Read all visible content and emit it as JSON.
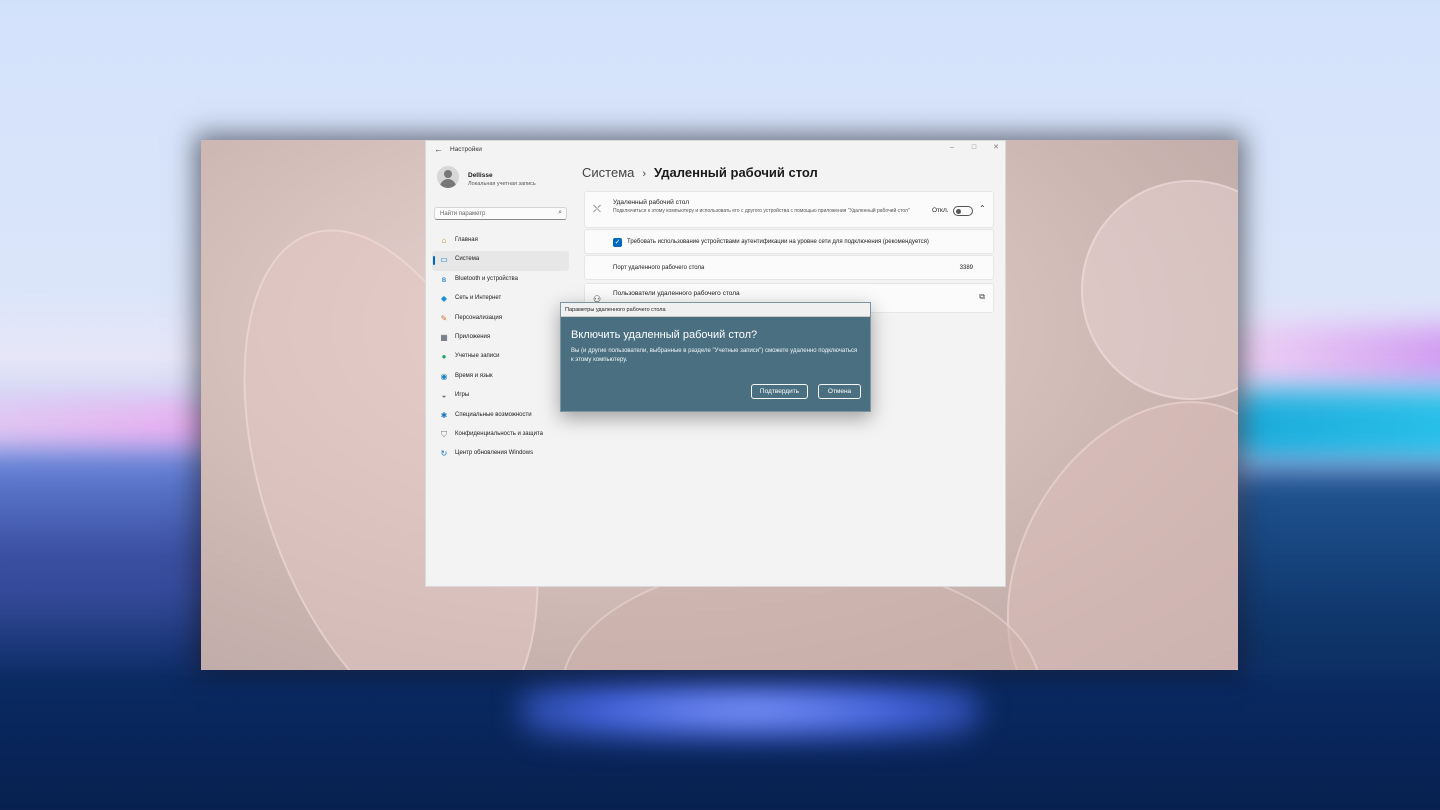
{
  "window": {
    "title": "Настройки",
    "back_icon": "arrow-left-icon",
    "controls": {
      "minimize_icon": "–",
      "maximize_icon": "□",
      "close_icon": "✕"
    }
  },
  "profile": {
    "name": "Dellisse",
    "account_type": "Локальная учетная запись",
    "avatar_icon": "person-avatar-icon"
  },
  "search": {
    "placeholder": "Найти параметр",
    "icon": "search-icon"
  },
  "nav": {
    "items": [
      {
        "label": "Главная",
        "icon": "home-icon",
        "glyph": "⌂",
        "color": "#c17a1b",
        "active": false
      },
      {
        "label": "Система",
        "icon": "monitor-icon",
        "glyph": "▭",
        "color": "#0a72c7",
        "active": true
      },
      {
        "label": "Bluetooth и устройства",
        "icon": "bluetooth-icon",
        "glyph": "ʙ",
        "color": "#0a72c7",
        "active": false
      },
      {
        "label": "Сеть и Интернет",
        "icon": "wifi-icon",
        "glyph": "◆",
        "color": "#1f8fd6",
        "active": false
      },
      {
        "label": "Персонализация",
        "icon": "brush-icon",
        "glyph": "✎",
        "color": "#d3702b",
        "active": false
      },
      {
        "label": "Приложения",
        "icon": "apps-icon",
        "glyph": "▦",
        "color": "#4b5766",
        "active": false
      },
      {
        "label": "Учетные записи",
        "icon": "accounts-icon",
        "glyph": "●",
        "color": "#21a366",
        "active": false
      },
      {
        "label": "Время и язык",
        "icon": "globe-icon",
        "glyph": "◉",
        "color": "#1d7fbf",
        "active": false
      },
      {
        "label": "Игры",
        "icon": "gamepad-icon",
        "glyph": "◒",
        "color": "#6b7480",
        "active": false
      },
      {
        "label": "Специальные возможности",
        "icon": "accessibility-icon",
        "glyph": "✱",
        "color": "#1a74c4",
        "active": false
      },
      {
        "label": "Конфиденциальность и защита",
        "icon": "shield-icon",
        "glyph": "⛉",
        "color": "#6b7480",
        "active": false
      },
      {
        "label": "Центр обновления Windows",
        "icon": "update-icon",
        "glyph": "↻",
        "color": "#0a72c7",
        "active": false
      }
    ]
  },
  "breadcrumb": {
    "parent": "Система",
    "separator": "›",
    "current": "Удаленный рабочий стол"
  },
  "rdp": {
    "title": "Удаленный рабочий стол",
    "description": "Подключиться к этому компьютеру и использовать его с другого устройства с помощью приложения \"Удаленный рабочий стол\"",
    "toggle_label": "Откл.",
    "toggle_on": false,
    "icon": "remote-desktop-icon",
    "expand_icon": "chevron-up-icon"
  },
  "nla": {
    "label": "Требовать использование устройствами аутентификации на уровне сети для подключения (рекомендуется)",
    "checked": true
  },
  "port": {
    "label": "Порт удаленного рабочего стола",
    "value": "3389"
  },
  "users": {
    "title": "Пользователи удаленного рабочего стола",
    "icon": "users-icon",
    "link_icon": "external-link-icon"
  },
  "dialog": {
    "window_title": "Параметры удаленного рабочего стола",
    "heading": "Включить удаленный рабочий стол?",
    "message": "Вы (и другие пользователи, выбранные в разделе \"Учетные записи\") сможете удаленно подключаться к этому компьютеру.",
    "confirm_label": "Подтвердить",
    "cancel_label": "Отмена",
    "background_color": "#4a6f81"
  },
  "colors": {
    "accent": "#0067c0",
    "window_bg": "#f3f3f3",
    "card_bg": "#fbfbfb"
  }
}
